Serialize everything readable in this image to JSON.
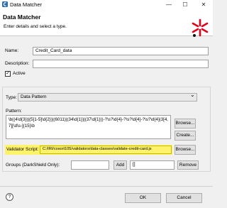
{
  "window": {
    "title": "Data Matcher",
    "minimize": "—",
    "maximize": "☐",
    "close": "✕"
  },
  "header": {
    "title": "Data Matcher",
    "description": "Enter details and select a type."
  },
  "form": {
    "name_label": "Name:",
    "name_value": "Credit_Card_data",
    "description_label": "Description:",
    "description_value": "",
    "active_label": "Active",
    "active_checked": "✓",
    "type_label": "Type:",
    "type_value": "Data Pattern",
    "pattern_label": "Pattern:",
    "pattern_value": "\\b((4\\d{3})|(5[1-5]\\d{2})|(6011)|(34\\d{1})|(37\\d{1}))-?\\s?\\d{4}-?\\s?\\d{4}-?\\s?\\d{4}|3[4,7][\\d\\s-]{15}\\b",
    "validator_label": "Validator Script:",
    "validator_value": "C:/IRI/cosort105/validators/data-classes/validate-credit-card.js",
    "groups_label": "Groups (DarkShield Only):",
    "groups_value": "",
    "groups_list_value": "[]"
  },
  "buttons": {
    "browse_pattern": "Browse...",
    "create": "Create...",
    "browse_validator": "Browse...",
    "add": "Add",
    "remove": "Remove",
    "ok": "OK",
    "cancel": "Cancel"
  },
  "icons": {
    "help": "?",
    "dropdown": "⌄"
  },
  "colors": {
    "highlight": "#fff36b",
    "logo_red": "#e2001a"
  }
}
